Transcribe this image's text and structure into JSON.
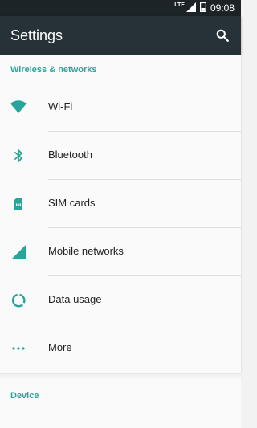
{
  "status": {
    "network": "LTE",
    "time": "09:08"
  },
  "appbar": {
    "title": "Settings"
  },
  "sections": {
    "wireless": {
      "header": "Wireless & networks",
      "items": [
        {
          "label": "Wi-Fi",
          "icon": "wifi-icon"
        },
        {
          "label": "Bluetooth",
          "icon": "bluetooth-icon"
        },
        {
          "label": "SIM cards",
          "icon": "sim-card-icon"
        },
        {
          "label": "Mobile networks",
          "icon": "mobile-signal-icon"
        },
        {
          "label": "Data usage",
          "icon": "data-usage-icon"
        },
        {
          "label": "More",
          "icon": "more-dots-icon"
        }
      ]
    },
    "device": {
      "header": "Device"
    }
  },
  "colors": {
    "accent": "#26a69a",
    "appbar": "#263238",
    "statusbar": "#1c2428",
    "background": "#fafafa"
  }
}
